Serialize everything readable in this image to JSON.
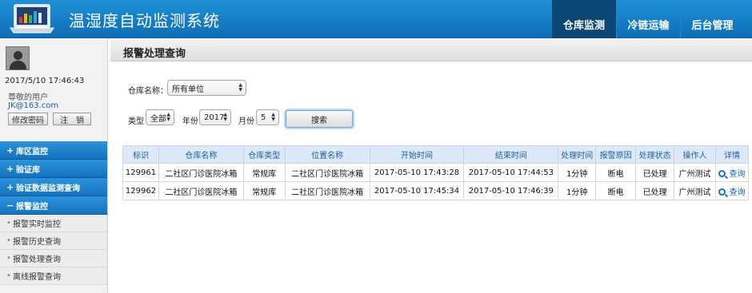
{
  "header": {
    "app_title": "温湿度自动监测系统",
    "nav": [
      {
        "label": "仓库监测",
        "active": true
      },
      {
        "label": "冷链运输",
        "active": false
      },
      {
        "label": "后台管理",
        "active": false
      }
    ]
  },
  "sidebar": {
    "datetime": "2017/5/10 17:46:43",
    "greeting": "尊敬的用户",
    "email": "JK@163.com",
    "change_password_label": "修改密码",
    "logout_label": "注　销",
    "menu": [
      {
        "sign": "+",
        "label": "库区监控"
      },
      {
        "sign": "+",
        "label": "验证库"
      },
      {
        "sign": "+",
        "label": "验证数据监测查询"
      },
      {
        "sign": "−",
        "label": "报警监控"
      }
    ],
    "submenu": [
      {
        "label": "报警实时监控"
      },
      {
        "label": "报警历史查询"
      },
      {
        "label": "报警处理查询"
      },
      {
        "label": "离线报警查询"
      }
    ]
  },
  "main": {
    "page_title": "报警处理查询",
    "filters": {
      "warehouse_label": "仓库名称：",
      "warehouse_value": "所有单位",
      "type_label": "类型",
      "type_value": "全部",
      "year_label": "年份",
      "year_value": "2017",
      "month_label": "月份",
      "month_value": "5",
      "search_label": "搜索"
    },
    "table": {
      "headers": [
        "标识",
        "仓库名称",
        "仓库类型",
        "位置名称",
        "开始时间",
        "结束时间",
        "处理时间",
        "报警原因",
        "处理状态",
        "操作人",
        "详情"
      ],
      "rows": [
        [
          "129961",
          "二社区门诊医院冰箱",
          "常规库",
          "二社区门诊医院冰箱",
          "2017-05-10 17:43:28",
          "2017-05-10 17:44:53",
          "1分钟",
          "断电",
          "已处理",
          "广州测试",
          "查询"
        ],
        [
          "129962",
          "二社区门诊医院冰箱",
          "常规库",
          "二社区门诊医院冰箱",
          "2017-05-10 17:45:34",
          "2017-05-10 17:46:39",
          "1分钟",
          "断电",
          "已处理",
          "广州测试",
          "查询"
        ]
      ]
    }
  }
}
